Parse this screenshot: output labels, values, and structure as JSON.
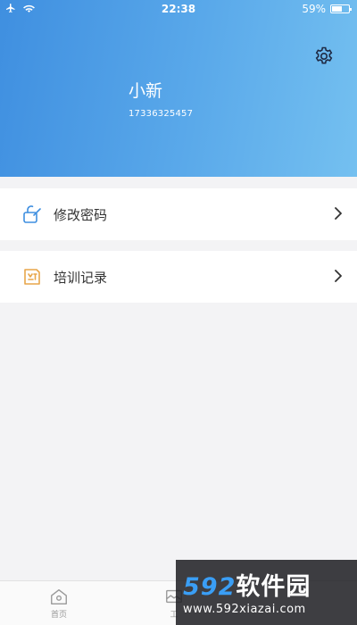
{
  "status_bar": {
    "time": "22:38",
    "battery_percent": "59%",
    "battery_level": 0.59,
    "icons": [
      "airplane-icon",
      "wifi-icon",
      "battery-icon"
    ]
  },
  "header": {
    "user_name": "小新",
    "phone": "17336325457",
    "settings_icon": "gear-icon"
  },
  "menu": {
    "items": [
      {
        "label": "修改密码",
        "icon": "edit-password-icon"
      },
      {
        "label": "培训记录",
        "icon": "training-record-icon"
      }
    ]
  },
  "tabbar": {
    "tabs": [
      {
        "label": "首页",
        "icon": "home-icon"
      },
      {
        "label": "工",
        "icon": "work-icon"
      }
    ]
  },
  "watermark": {
    "brand_number": "592",
    "brand_text": "软件园",
    "url": "www.592xiazai.com"
  },
  "colors": {
    "header_start": "#3f8fe0",
    "header_end": "#74c0f0",
    "icon_blue": "#3f8fe0",
    "icon_orange": "#e8a64a"
  }
}
